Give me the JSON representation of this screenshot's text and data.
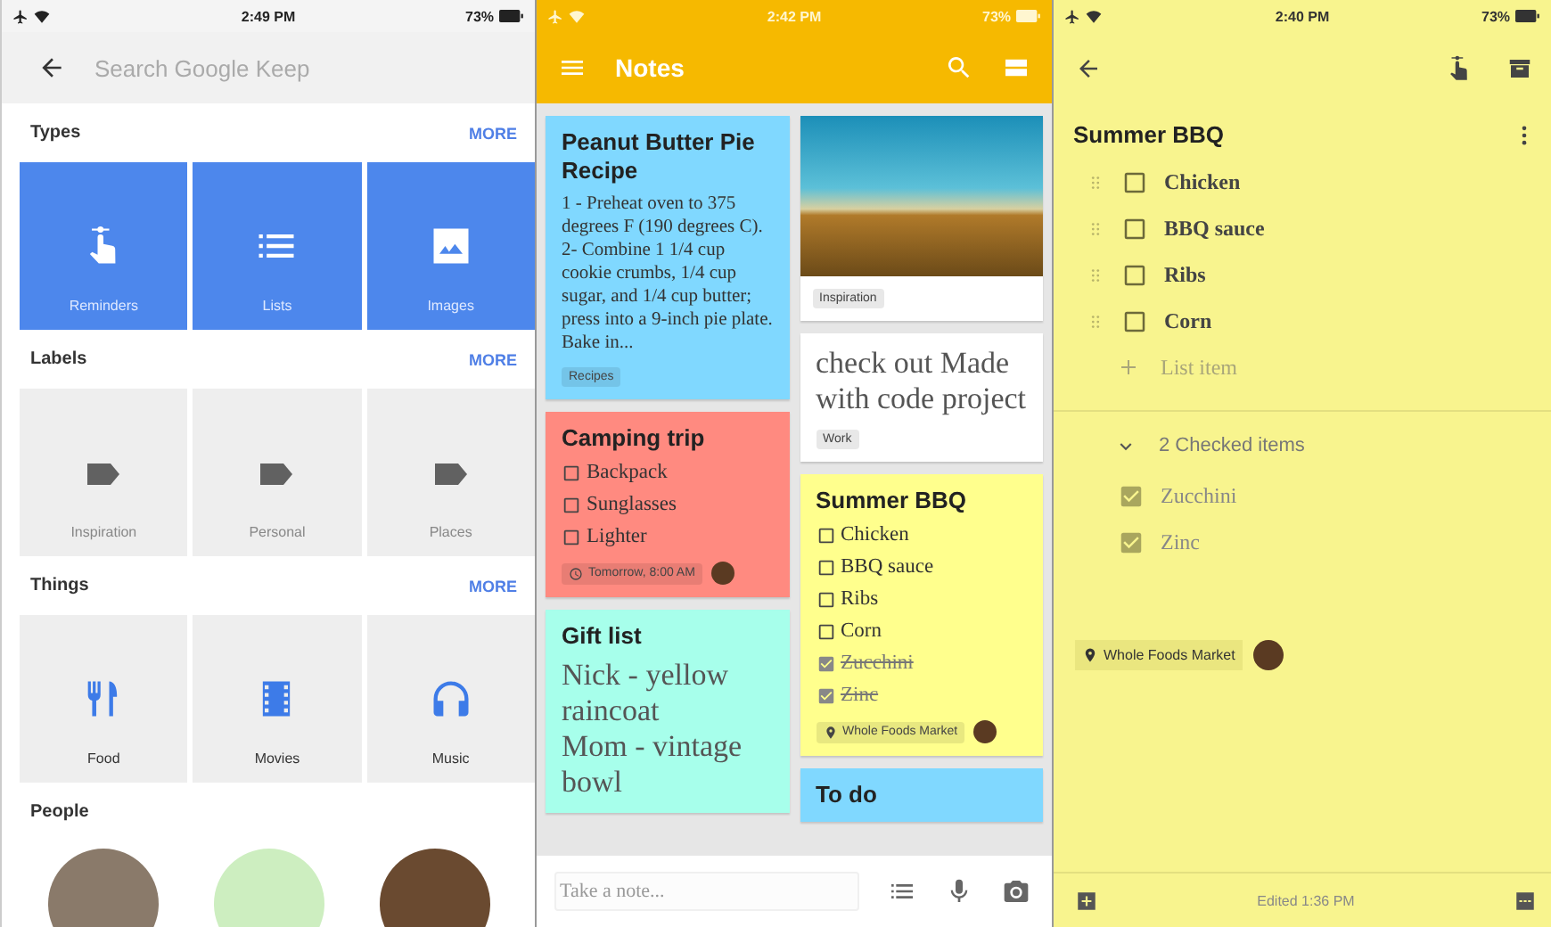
{
  "search_screen": {
    "status_bar": {
      "time": "2:49 PM",
      "battery": "73%"
    },
    "search": {
      "placeholder": "Search Google Keep"
    },
    "sections": [
      {
        "kind": "types",
        "title": "Types",
        "more": "MORE",
        "tiles": [
          {
            "label": "Reminders"
          },
          {
            "label": "Lists"
          },
          {
            "label": "Images"
          }
        ]
      },
      {
        "kind": "labels",
        "title": "Labels",
        "more": "MORE",
        "tiles": [
          {
            "label": "Inspiration"
          },
          {
            "label": "Personal"
          },
          {
            "label": "Places"
          }
        ]
      },
      {
        "kind": "things",
        "title": "Things",
        "more": "MORE",
        "tiles": [
          {
            "label": "Food"
          },
          {
            "label": "Movies"
          },
          {
            "label": "Music"
          }
        ]
      },
      {
        "kind": "people",
        "title": "People"
      }
    ]
  },
  "notes_screen": {
    "status_bar": {
      "time": "2:42 PM",
      "battery": "73%"
    },
    "app_bar": {
      "title": "Notes"
    },
    "columns": [
      {
        "notes": [
          {
            "kind": "text",
            "color": "#80d8ff",
            "title": "Peanut Butter Pie Recipe",
            "body": "1 - Preheat oven to 375 degrees F (190 degrees C).\n2- Combine 1 1/4 cup cookie crumbs, 1/4 cup sugar, and 1/4 cup butter; press into a 9-inch pie plate. Bake in...",
            "chips": [
              {
                "kind": "label",
                "text": "Recipes"
              }
            ]
          },
          {
            "kind": "list",
            "color": "#ff8a80",
            "title": "Camping trip",
            "items": [
              {
                "text": "Backpack",
                "checked": false
              },
              {
                "text": "Sunglasses",
                "checked": false
              },
              {
                "text": "Lighter",
                "checked": false
              }
            ],
            "chips": [
              {
                "kind": "reminder",
                "text": "Tomorrow, 8:00 AM"
              }
            ],
            "shared": true
          },
          {
            "kind": "short_text",
            "color": "#a7ffeb",
            "title": "Gift list",
            "body": "Nick - yellow raincoat\nMom - vintage bowl"
          }
        ]
      },
      {
        "notes": [
          {
            "kind": "image",
            "color": "#ffffff",
            "chips": [
              {
                "kind": "label",
                "text": "Inspiration"
              }
            ]
          },
          {
            "kind": "short_text",
            "color": "#ffffff",
            "body": "check out Made with code project",
            "chips": [
              {
                "kind": "label",
                "text": "Work"
              }
            ]
          },
          {
            "kind": "list",
            "color": "#ffff8d",
            "title": "Summer BBQ",
            "items": [
              {
                "text": "Chicken",
                "checked": false
              },
              {
                "text": "BBQ sauce",
                "checked": false
              },
              {
                "text": "Ribs",
                "checked": false
              },
              {
                "text": "Corn",
                "checked": false
              },
              {
                "text": "Zucchini",
                "checked": true
              },
              {
                "text": "Zinc",
                "checked": true
              }
            ],
            "chips": [
              {
                "kind": "location",
                "text": "Whole Foods Market"
              }
            ],
            "shared": true
          },
          {
            "kind": "text",
            "color": "#80d8ff",
            "title": "To do"
          }
        ]
      }
    ],
    "take_note": {
      "placeholder": "Take a note..."
    }
  },
  "note_screen": {
    "status_bar": {
      "time": "2:40 PM",
      "battery": "73%"
    },
    "title": "Summer BBQ",
    "items": [
      {
        "text": "Chicken",
        "checked": false
      },
      {
        "text": "BBQ sauce",
        "checked": false
      },
      {
        "text": "Ribs",
        "checked": false
      },
      {
        "text": "Corn",
        "checked": false
      }
    ],
    "add_item": {
      "placeholder": "List item"
    },
    "checked_group": {
      "label": "2 Checked items",
      "expanded": true,
      "items": [
        {
          "text": "Zucchini",
          "checked": true
        },
        {
          "text": "Zinc",
          "checked": true
        }
      ]
    },
    "chips": [
      {
        "kind": "location",
        "text": "Whole Foods Market"
      }
    ],
    "shared": true,
    "footer": {
      "edited": "Edited 1:36 PM"
    }
  }
}
